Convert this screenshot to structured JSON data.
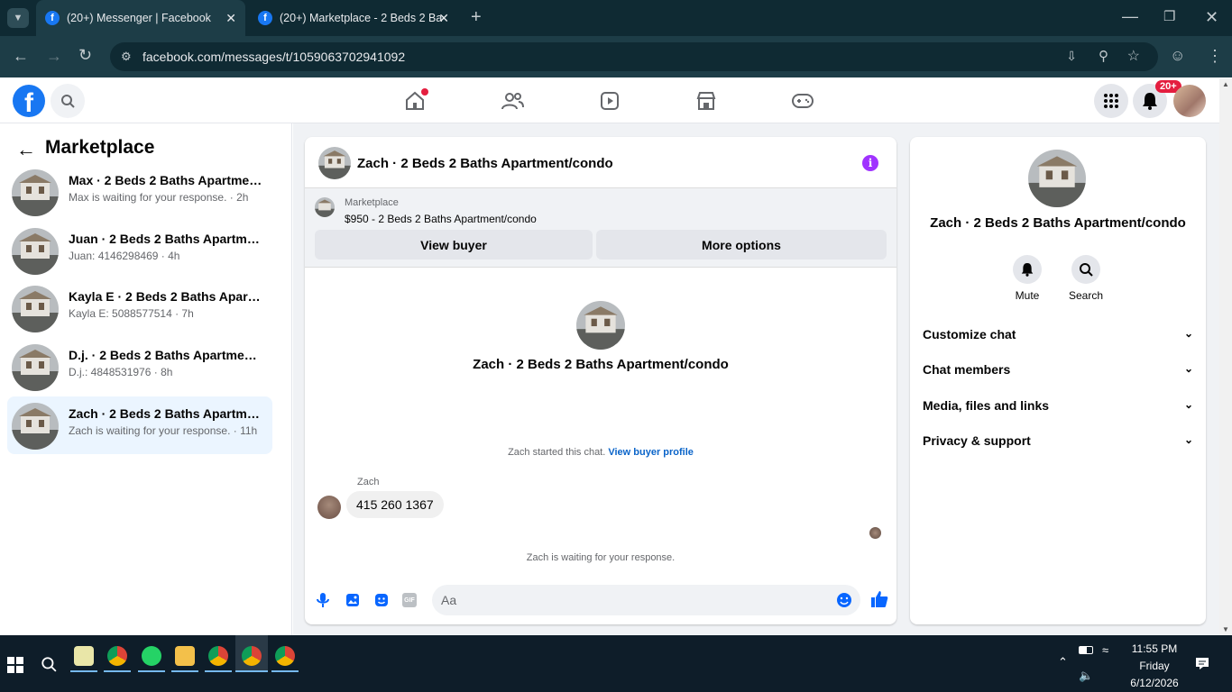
{
  "browser": {
    "tabs": [
      {
        "title": "(20+) Messenger | Facebook",
        "active": true
      },
      {
        "title": "(20+) Marketplace - 2 Beds 2 Ba",
        "active": false
      }
    ],
    "url": "facebook.com/messages/t/1059063702941092"
  },
  "header": {
    "notif_badge": "20+"
  },
  "sidebar": {
    "title": "Marketplace",
    "conversations": [
      {
        "title": "Max · 2 Beds 2 Baths Apartment...",
        "snippet": "Max is waiting for your response. · 2h",
        "selected": false
      },
      {
        "title": "Juan · 2 Beds 2 Baths Apartmen...",
        "snippet": "Juan: 4146298469 · 4h",
        "selected": false
      },
      {
        "title": "Kayla E · 2 Beds 2 Baths Apartm...",
        "snippet": "Kayla E: 5088577514 · 7h",
        "selected": false
      },
      {
        "title": "D.j. · 2 Beds 2 Baths Apartment/...",
        "snippet": "D.j.: 4848531976 · 8h",
        "selected": false
      },
      {
        "title": "Zach · 2 Beds 2 Baths Apartmen...",
        "snippet": "Zach is waiting for your response. · 11h",
        "selected": true
      }
    ]
  },
  "chat": {
    "title": "Zach · 2 Beds 2 Baths Apartment/condo",
    "marketplace_label": "Marketplace",
    "listing": "$950 - 2 Beds 2 Baths Apartment/condo",
    "view_buyer": "View buyer",
    "more_options": "More options",
    "profile_name": "Zach · 2 Beds 2 Baths Apartment/condo",
    "started": "Zach started this chat.",
    "view_profile": "View buyer profile",
    "sender": "Zach",
    "message": "415 260 1367",
    "waiting": "Zach is waiting for your response.",
    "composer_placeholder": "Aa"
  },
  "details": {
    "name": "Zach · 2 Beds 2 Baths Apartment/condo",
    "mute": "Mute",
    "search": "Search",
    "sections": [
      "Customize chat",
      "Chat members",
      "Media, files and links",
      "Privacy & support"
    ]
  },
  "taskbar": {
    "time": "11:55 PM",
    "day": "Friday",
    "date": "6/12/2026"
  }
}
